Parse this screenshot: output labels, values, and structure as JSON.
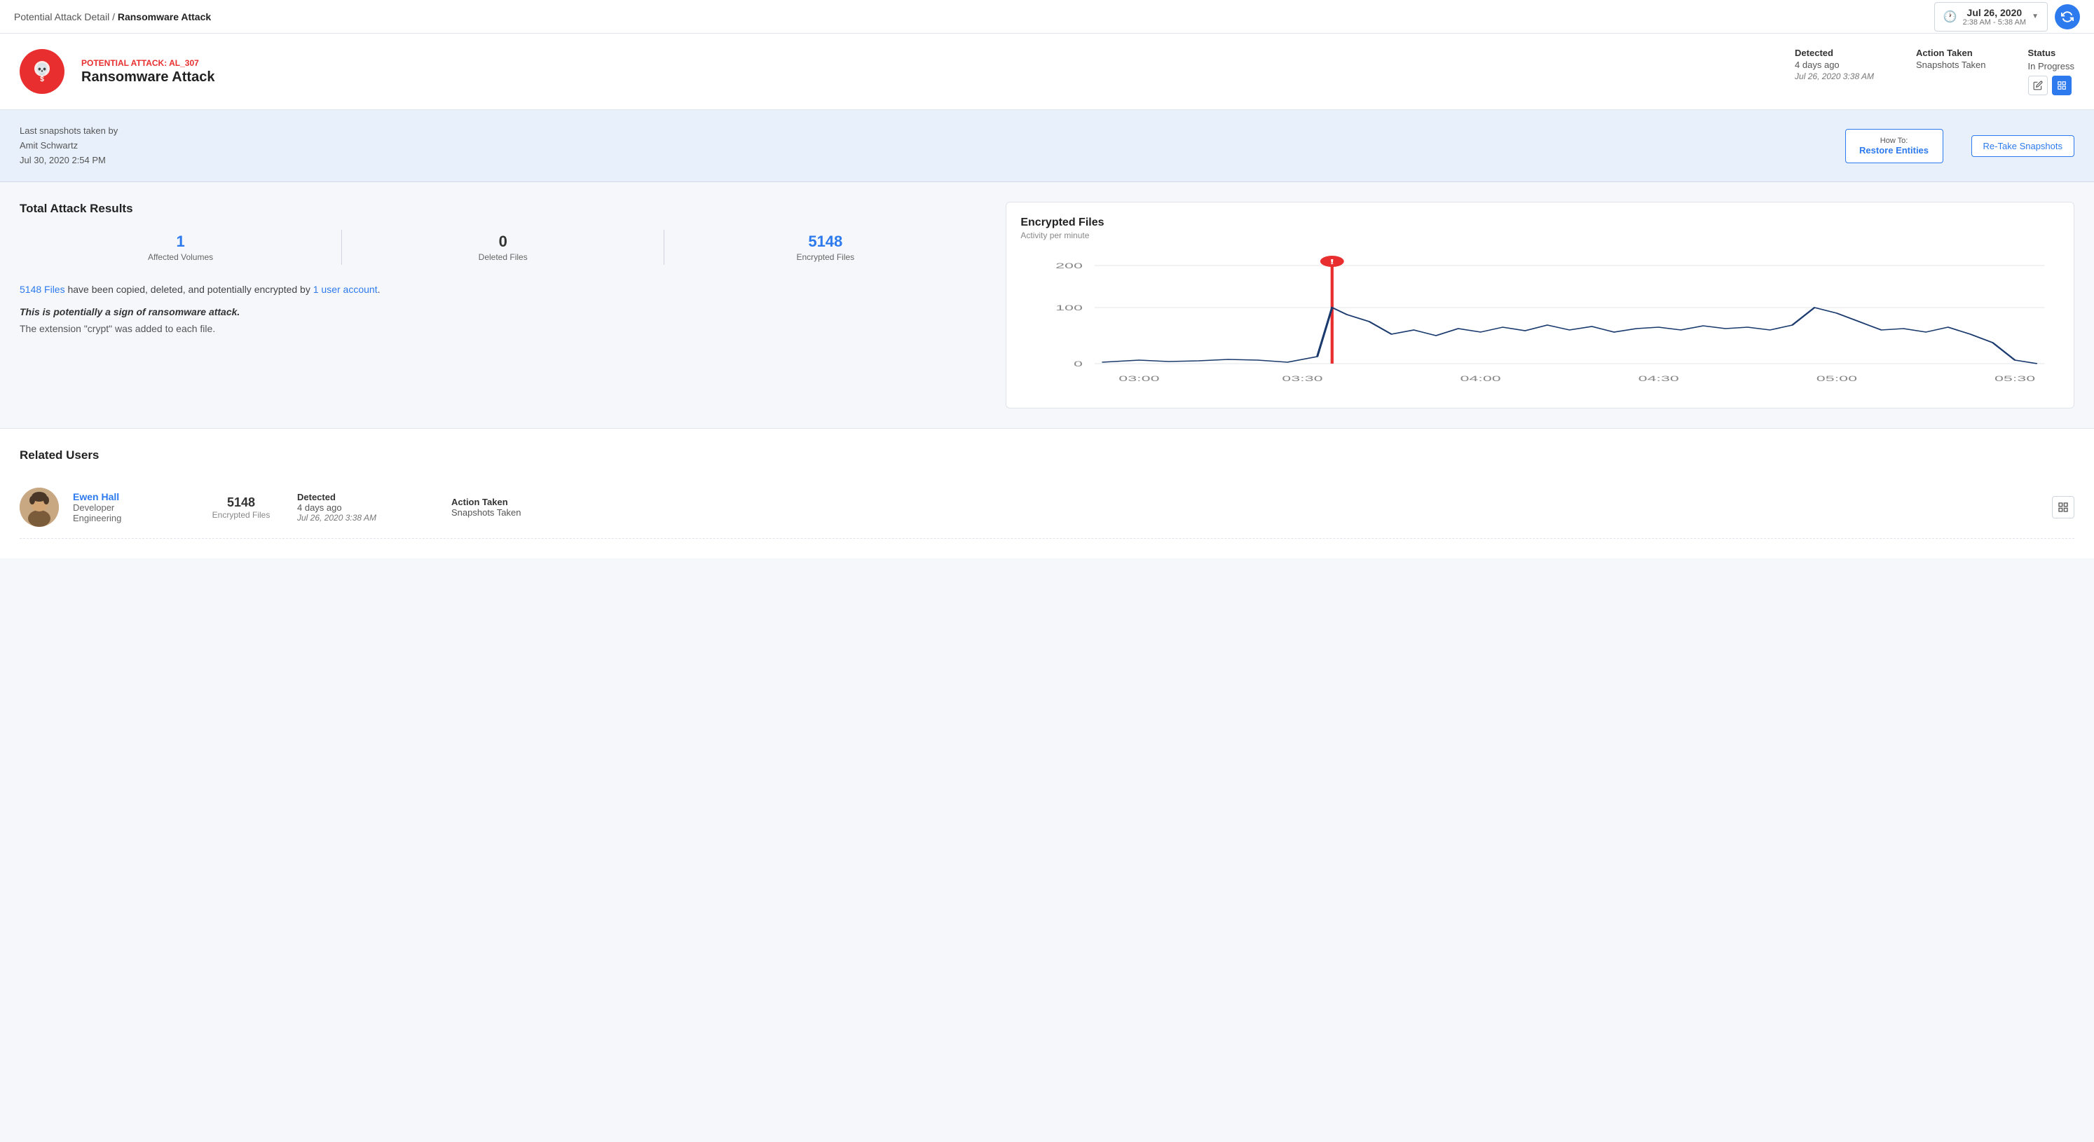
{
  "breadcrumb": {
    "parent": "Potential Attack Detail",
    "separator": "/",
    "current": "Ransomware Attack"
  },
  "dateRange": {
    "date": "Jul 26, 2020",
    "time": "2:38 AM - 5:38 AM"
  },
  "alert": {
    "id": "POTENTIAL ATTACK: AL_307",
    "title": "Ransomware Attack",
    "detected_label": "Detected",
    "detected_ago": "4 days ago",
    "detected_date": "Jul 26, 2020 3:38 AM",
    "action_taken_label": "Action Taken",
    "action_taken_value": "Snapshots Taken",
    "status_label": "Status",
    "status_value": "In Progress"
  },
  "snapshot": {
    "last_label": "Last snapshots taken by",
    "taken_by": "Amit Schwartz",
    "taken_date": "Jul 30, 2020 2:54 PM",
    "how_to_label": "How To:",
    "how_to_main": "Restore Entities",
    "retake_label": "Re-Take Snapshots"
  },
  "stats": {
    "section_title": "Total Attack Results",
    "affected_volumes_value": "1",
    "affected_volumes_label": "Affected Volumes",
    "deleted_files_value": "0",
    "deleted_files_label": "Deleted Files",
    "encrypted_files_value": "5148",
    "encrypted_files_label": "Encrypted Files"
  },
  "description": {
    "files_count": "5148 Files",
    "files_text": " have been copied, deleted, and potentially encrypted by ",
    "user_count": "1 user account",
    "period": ".",
    "warning": "This is potentially a sign of ransomware attack.",
    "extension": "The extension \"crypt\" was added to each file."
  },
  "chart": {
    "title": "Encrypted Files",
    "subtitle": "Activity per minute",
    "y_labels": [
      "200",
      "100",
      "0"
    ],
    "x_labels": [
      "03:00",
      "03:30",
      "04:00",
      "04:30",
      "05:00",
      "05:30"
    ],
    "attack_time": "03:30"
  },
  "related_users": {
    "section_title": "Related Users",
    "users": [
      {
        "name": "Ewen Hall",
        "role": "Developer",
        "department": "Engineering",
        "encrypted_files": "5148",
        "encrypted_label": "Encrypted Files",
        "detected_label": "Detected",
        "detected_ago": "4 days ago",
        "detected_date": "Jul 26, 2020 3:38 AM",
        "action_label": "Action Taken",
        "action_value": "Snapshots Taken"
      }
    ]
  }
}
